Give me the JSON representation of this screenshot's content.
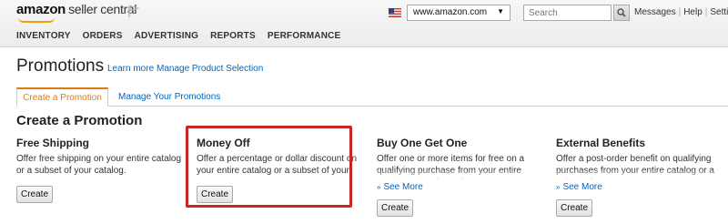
{
  "brand": {
    "name": "amazon",
    "product": "seller central"
  },
  "header": {
    "marketplace": "www.amazon.com",
    "search_placeholder": "Search",
    "links": [
      "Messages",
      "Help",
      "Settings"
    ]
  },
  "nav": [
    "INVENTORY",
    "ORDERS",
    "ADVERTISING",
    "REPORTS",
    "PERFORMANCE"
  ],
  "page": {
    "title": "Promotions",
    "links": [
      "Learn more",
      "Manage Product Selection"
    ]
  },
  "tabs": [
    {
      "label": "Create a Promotion",
      "active": true
    },
    {
      "label": "Manage Your Promotions",
      "active": false
    }
  ],
  "section_title": "Create a Promotion",
  "cards": [
    {
      "title": "Free Shipping",
      "description": "Offer free shipping on your entire catalog or a subset of your catalog.",
      "button": "Create"
    },
    {
      "title": "Money Off",
      "description": "Offer a percentage or dollar discount on your entire catalog or a subset of your catalog.",
      "button": "Create",
      "highlighted": true
    },
    {
      "title": "Buy One Get One",
      "description": "Offer one or more items for free on a qualifying purchase from your entire catalog or a subset of",
      "see_more": "See More",
      "button": "Create"
    },
    {
      "title": "External Benefits",
      "description": "Offer a post-order benefit on qualifying purchases from your entire catalog or a subset of",
      "see_more": "See More",
      "button": "Create"
    }
  ],
  "colors": {
    "accent": "#e47911",
    "link": "#0066c0",
    "highlight": "#c62828"
  }
}
